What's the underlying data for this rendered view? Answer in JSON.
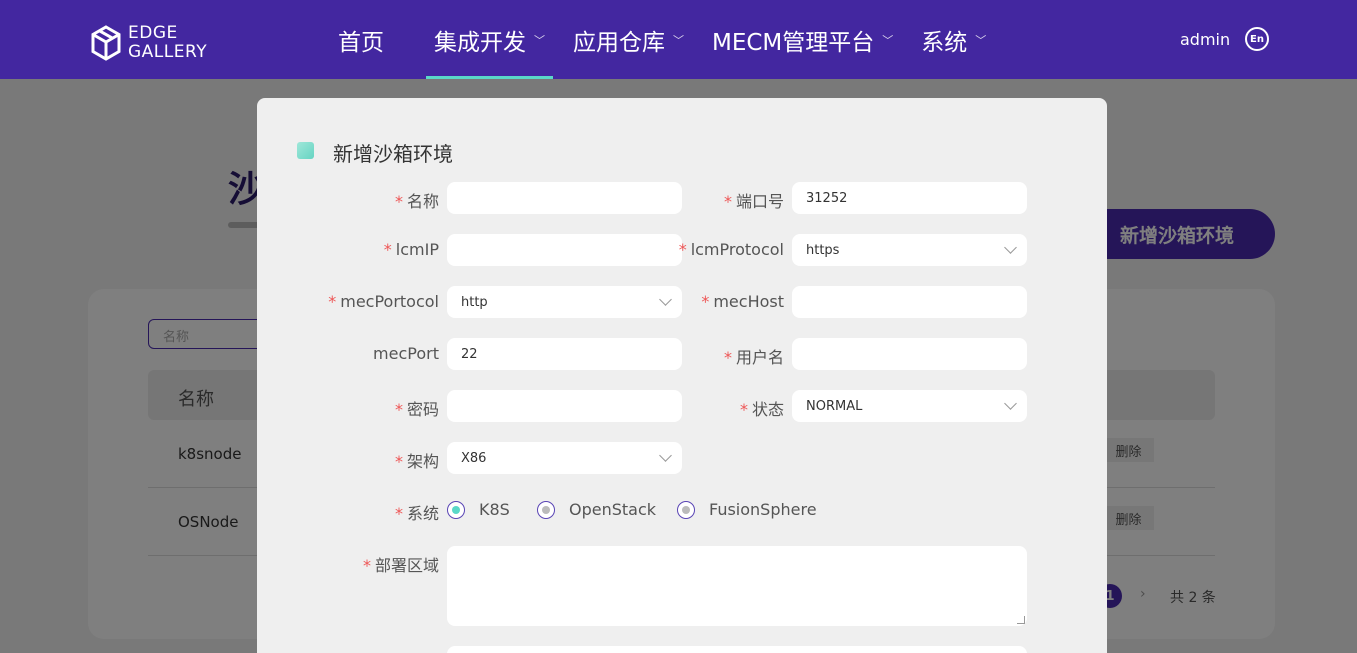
{
  "header": {
    "logo_line1": "EDGE",
    "logo_line2": "GALLERY",
    "nav": [
      {
        "label": "首页"
      },
      {
        "label": "集成开发"
      },
      {
        "label": "应用仓库"
      },
      {
        "label": "MECM管理平台"
      },
      {
        "label": "系统"
      }
    ],
    "user": "admin",
    "lang": "En"
  },
  "background_page": {
    "title": "沙",
    "add_button": "新增沙箱环境",
    "search_placeholder": "名称",
    "column_name": "名称",
    "rows": [
      {
        "name": "k8snode",
        "action": "删除"
      },
      {
        "name": "OSNode",
        "action": "删除"
      }
    ],
    "current_page": "1",
    "next": "›",
    "total": "共 2 条"
  },
  "dialog": {
    "title": "新增沙箱环境",
    "fields": {
      "name": {
        "label": "名称",
        "value": ""
      },
      "port": {
        "label": "端口号",
        "value": "31252"
      },
      "lcmip": {
        "label": "lcmIP",
        "value": ""
      },
      "lcmprotocol": {
        "label": "lcmProtocol",
        "value": "https"
      },
      "mecportocol": {
        "label": "mecPortocol",
        "value": "http"
      },
      "mechost": {
        "label": "mecHost",
        "value": ""
      },
      "mecport": {
        "label": "mecPort",
        "value": "22"
      },
      "username": {
        "label": "用户名",
        "value": ""
      },
      "password": {
        "label": "密码",
        "value": ""
      },
      "status": {
        "label": "状态",
        "value": "NORMAL"
      },
      "arch": {
        "label": "架构",
        "value": "X86"
      },
      "system": {
        "label": "系统",
        "options": [
          "K8S",
          "OpenStack",
          "FusionSphere"
        ],
        "selected": "K8S"
      },
      "region": {
        "label": "部署区域",
        "value": ""
      }
    },
    "required_mark": "*"
  },
  "colors": {
    "header_bg": "#4327a0",
    "accent": "#5ad8c8",
    "required": "#e55555"
  }
}
